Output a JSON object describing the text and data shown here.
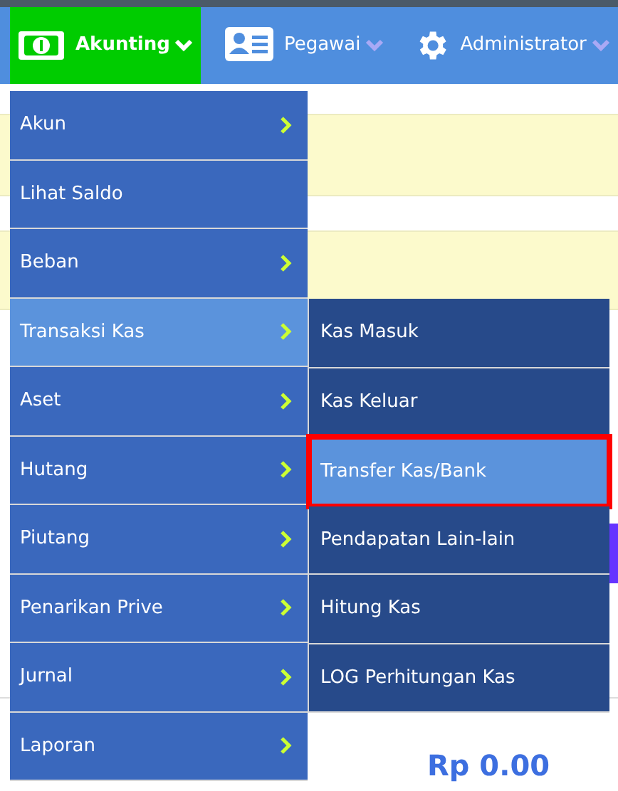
{
  "navbar": {
    "items": [
      {
        "label": "Akunting",
        "selected": true
      },
      {
        "label": "Pegawai",
        "selected": false
      },
      {
        "label": "Administrator",
        "selected": false
      }
    ]
  },
  "page": {
    "value_right": "Rp 0.00"
  },
  "menu": {
    "items": [
      {
        "label": "Akun",
        "has_submenu": true,
        "selected": false
      },
      {
        "label": "Lihat Saldo",
        "has_submenu": false,
        "selected": false
      },
      {
        "label": "Beban",
        "has_submenu": true,
        "selected": false
      },
      {
        "label": "Transaksi Kas",
        "has_submenu": true,
        "selected": true
      },
      {
        "label": "Aset",
        "has_submenu": true,
        "selected": false
      },
      {
        "label": "Hutang",
        "has_submenu": true,
        "selected": false
      },
      {
        "label": "Piutang",
        "has_submenu": true,
        "selected": false
      },
      {
        "label": "Penarikan Prive",
        "has_submenu": true,
        "selected": false
      },
      {
        "label": "Jurnal",
        "has_submenu": true,
        "selected": false
      },
      {
        "label": "Laporan",
        "has_submenu": true,
        "selected": false
      }
    ]
  },
  "submenu": {
    "items": [
      {
        "label": "Kas Masuk",
        "selected": false
      },
      {
        "label": "Kas Keluar",
        "selected": false
      },
      {
        "label": "Transfer Kas/Bank",
        "selected": true
      },
      {
        "label": "Pendapatan Lain-lain",
        "selected": false
      },
      {
        "label": "Hitung Kas",
        "selected": false
      },
      {
        "label": "LOG Perhitungan Kas",
        "selected": false
      }
    ]
  }
}
